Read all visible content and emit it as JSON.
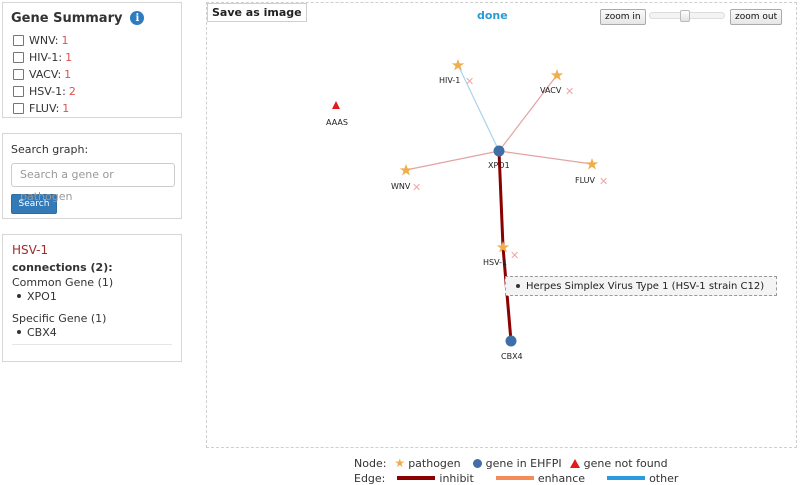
{
  "summary": {
    "title": "Gene Summary",
    "info_glyph": "i",
    "items": [
      {
        "label": "WNV:",
        "count": "1"
      },
      {
        "label": "HIV-1:",
        "count": "1"
      },
      {
        "label": "VACV:",
        "count": "1"
      },
      {
        "label": "HSV-1:",
        "count": "2"
      },
      {
        "label": "FLUV:",
        "count": "1"
      }
    ]
  },
  "search": {
    "label": "Search graph:",
    "placeholder": "Search a gene or pathogen",
    "button": "Search"
  },
  "info": {
    "title": "HSV-1",
    "connections_label": "connections (2):",
    "common_heading": "Common Gene (1)",
    "common_items": [
      "XPO1"
    ],
    "specific_heading": "Specific Gene (1)",
    "specific_items": [
      "CBX4"
    ]
  },
  "toolbar": {
    "save_label": "Save as image",
    "status": "done",
    "zoom_in": "zoom in",
    "zoom_out": "zoom out",
    "zoom_level": 0.5
  },
  "graph": {
    "nodes": [
      {
        "id": "HIV-1",
        "label": "HIV-1",
        "type": "pathogen"
      },
      {
        "id": "VACV",
        "label": "VACV",
        "type": "pathogen"
      },
      {
        "id": "AAAS",
        "label": "AAAS",
        "type": "not_found"
      },
      {
        "id": "XPO1",
        "label": "XPO1",
        "type": "gene"
      },
      {
        "id": "WNV",
        "label": "WNV",
        "type": "pathogen"
      },
      {
        "id": "FLUV",
        "label": "FLUV",
        "type": "pathogen"
      },
      {
        "id": "HSV-1",
        "label": "HSV-1",
        "type": "pathogen"
      },
      {
        "id": "CBX4",
        "label": "CBX4",
        "type": "gene"
      }
    ],
    "edges": [
      {
        "source": "XPO1",
        "target": "HIV-1",
        "kind": "other"
      },
      {
        "source": "XPO1",
        "target": "VACV",
        "kind": "inhibit"
      },
      {
        "source": "XPO1",
        "target": "WNV",
        "kind": "inhibit"
      },
      {
        "source": "XPO1",
        "target": "FLUV",
        "kind": "inhibit"
      },
      {
        "source": "XPO1",
        "target": "HSV-1",
        "kind": "inhibit",
        "highlighted": true
      },
      {
        "source": "HSV-1",
        "target": "CBX4",
        "kind": "inhibit",
        "highlighted": true
      }
    ],
    "tooltip": "Herpes Simplex Virus Type 1 (HSV-1 strain C12)"
  },
  "legend": {
    "node_title": "Node:",
    "pathogen": "pathogen",
    "gene": "gene in EHFPI",
    "not_found": "gene not found",
    "edge_title": "Edge:",
    "inhibit": "inhibit",
    "enhance": "enhance",
    "other": "other"
  },
  "colors": {
    "pathogen": "#f0ad4e",
    "gene": "#3f6fa6",
    "not_found": "#e31a1c",
    "inhibit": "#8b0000",
    "inhibit_faded": "#e3a3a3",
    "enhance": "#f28c58",
    "other": "#2b9be0",
    "other_faded": "#a9d3ef",
    "accent": "#337ab7"
  }
}
